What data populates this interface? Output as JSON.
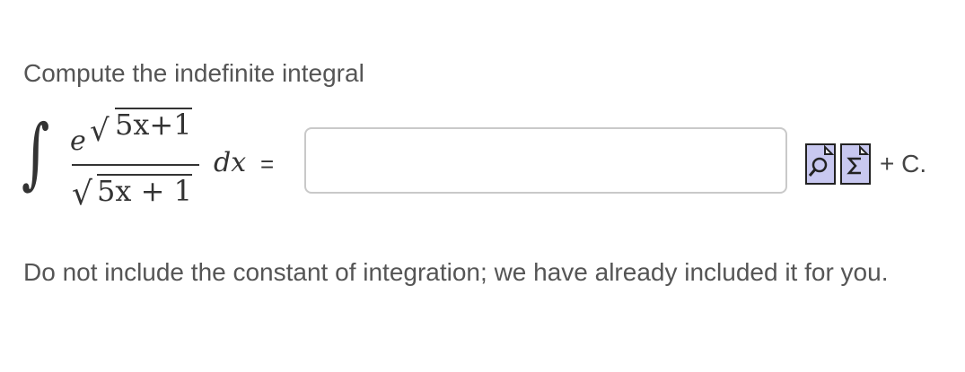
{
  "prompt": "Compute the indefinite integral",
  "integral": {
    "sign": "∫",
    "numerator_base": "e",
    "numerator_exponent": "5x+1",
    "denominator": "5x + 1",
    "differential": "dx",
    "equals": "="
  },
  "answer": {
    "value": "",
    "placeholder": ""
  },
  "tools": [
    {
      "name": "preview-icon"
    },
    {
      "name": "equation-editor-icon"
    }
  ],
  "constant": "+ C.",
  "note": "Do not include the constant of integration; we have already included it for you."
}
